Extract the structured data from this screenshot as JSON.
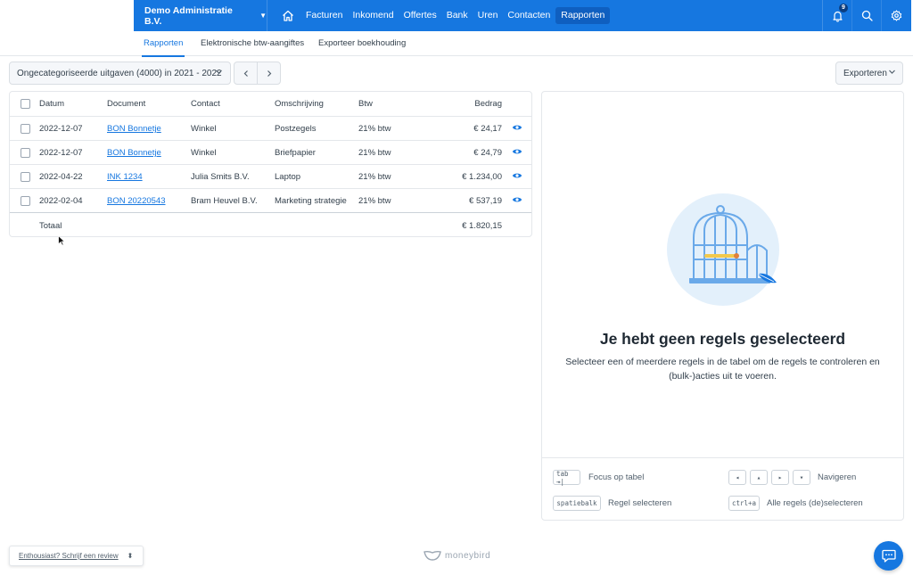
{
  "nav": {
    "company": "Demo Administratie B.V.",
    "links": [
      "Facturen",
      "Inkomend",
      "Offertes",
      "Bank",
      "Uren",
      "Contacten",
      "Rapporten"
    ],
    "active_link": "Rapporten",
    "notification_count": "9",
    "icons": [
      "home-icon",
      "bell-icon",
      "search-icon",
      "gear-icon"
    ]
  },
  "subtabs": {
    "items": [
      "Rapporten",
      "Elektronische btw-aangiftes",
      "Exporteer boekhouding"
    ],
    "active": "Rapporten"
  },
  "toolbar": {
    "select_value": "Ongecategoriseerde uitgaven (4000) in 2021 - 2022",
    "export_label": "Exporteren"
  },
  "table": {
    "headers": [
      "Datum",
      "Document",
      "Contact",
      "Omschrijving",
      "Btw",
      "Bedrag"
    ],
    "rows": [
      {
        "date": "2022-12-07",
        "document": "BON Bonnetje",
        "contact": "Winkel",
        "description": "Postzegels",
        "btw": "21% btw",
        "amount": "€ 24,17"
      },
      {
        "date": "2022-12-07",
        "document": "BON Bonnetje",
        "contact": "Winkel",
        "description": "Briefpapier",
        "btw": "21% btw",
        "amount": "€ 24,79"
      },
      {
        "date": "2022-04-22",
        "document": "INK 1234",
        "contact": "Julia Smits B.V.",
        "description": "Laptop",
        "btw": "21% btw",
        "amount": "€ 1.234,00"
      },
      {
        "date": "2022-02-04",
        "document": "BON 20220543",
        "contact": "Bram Heuvel B.V.",
        "description": "Marketing strategie",
        "btw": "21% btw",
        "amount": "€ 537,19"
      }
    ],
    "total_label": "Totaal",
    "total_amount": "€ 1.820,15"
  },
  "empty_state": {
    "title": "Je hebt geen regels geselecteerd",
    "description": "Selecteer een of meerdere regels in de tabel om de regels te controleren en (bulk-)acties uit te voeren."
  },
  "shortcuts": {
    "focus_key": "tab ⇥|",
    "focus_label": "Focus op tabel",
    "nav_keys": [
      "◂",
      "▴",
      "▸",
      "▾"
    ],
    "nav_label": "Navigeren",
    "select_key": "spatiebalk",
    "select_label": "Regel selecteren",
    "all_key": "ctrl+a",
    "all_label": "Alle regels (de)selecteren"
  },
  "footer": {
    "review_text": "Enthousiast? Schrijf een review",
    "logo_text": "moneybird"
  },
  "colors": {
    "brand": "#1677e0",
    "brand_dark": "#0f5fc0",
    "border": "#e4e7eb",
    "illustration_bg": "#e3f0fb"
  }
}
